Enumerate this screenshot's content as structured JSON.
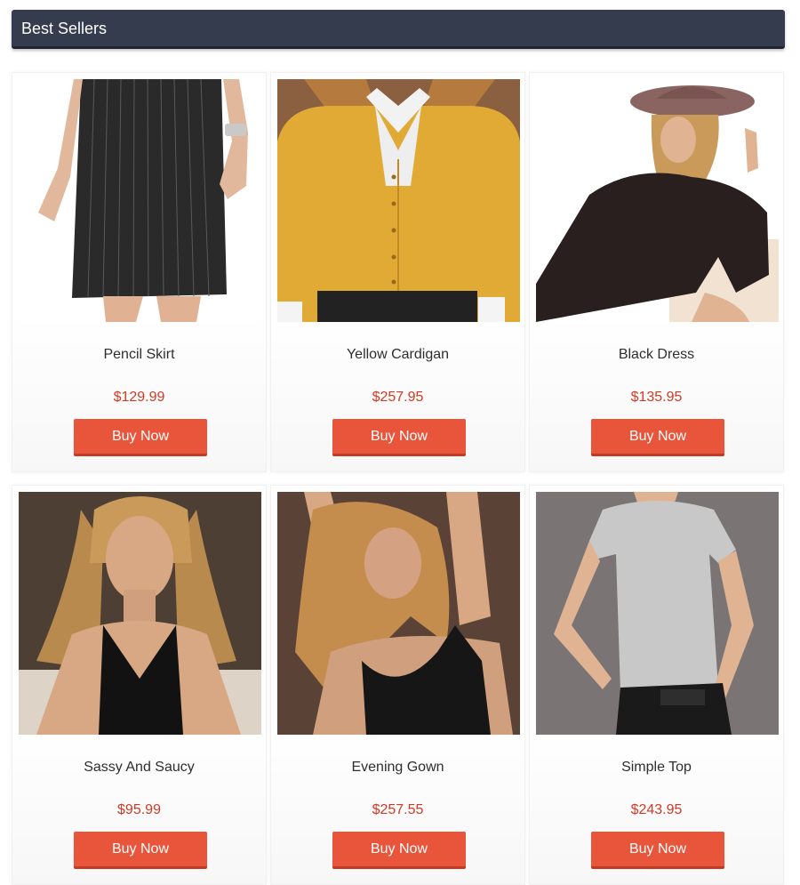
{
  "header": {
    "title": "Best Sellers"
  },
  "products": [
    {
      "name": "Pencil Skirt",
      "price": "$129.99",
      "button": "Buy Now"
    },
    {
      "name": "Yellow Cardigan",
      "price": "$257.95",
      "button": "Buy Now"
    },
    {
      "name": "Black Dress",
      "price": "$135.95",
      "button": "Buy Now"
    },
    {
      "name": "Sassy And Saucy",
      "price": "$95.99",
      "button": "Buy Now"
    },
    {
      "name": "Evening Gown",
      "price": "$257.55",
      "button": "Buy Now"
    },
    {
      "name": "Simple Top",
      "price": "$243.95",
      "button": "Buy Now"
    }
  ],
  "colors": {
    "header_bg": "#343c4d",
    "price": "#d23a26",
    "button_bg": "#e8553a"
  }
}
